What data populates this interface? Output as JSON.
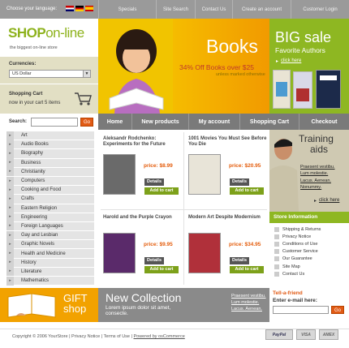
{
  "topbar": {
    "language_label": "Choose your language:",
    "nav": [
      "Specials",
      "Site Search",
      "Contact Us",
      "Create an account",
      "Customer Login"
    ]
  },
  "logo": {
    "main": "SHOP",
    "suffix": "on-line",
    "tagline": "the biggest on-line store"
  },
  "currencies": {
    "label": "Currencies:",
    "selected": "US Dollar"
  },
  "cart": {
    "label": "Shopping Cart",
    "text": "now in your cart  5 items"
  },
  "hero": {
    "title": "Books",
    "subtitle": "34% Off Books over $25",
    "note": "unless marked otherwise"
  },
  "big_sale": {
    "title": "BIG sale",
    "subtitle": "Favorite Authors",
    "link": "click here"
  },
  "search": {
    "label": "Search:",
    "go": "Go"
  },
  "main_nav": [
    "Home",
    "New products",
    "My account",
    "Shopping Cart",
    "Checkout"
  ],
  "categories": [
    "Art",
    "Audio Books",
    "Biography",
    "Business",
    "Christianity",
    "Computers",
    "Cooking and Food",
    "Crafts",
    "Eastern Religion",
    "Engineering",
    "Foreign Languages",
    "Gay and Lesbian",
    "Graphic Novels",
    "Health and Medicine",
    "History",
    "Literature",
    "Mathematics"
  ],
  "products": [
    {
      "title": "Aleksandr Rodchenko: Experiments for the Future",
      "price": "price: $8.99",
      "details": "Details",
      "add": "Add to cart",
      "cover_color": "#6a6a6a"
    },
    {
      "title": "1001 Movies You Must See Before You Die",
      "price": "price: $20.95",
      "details": "Details",
      "add": "Add to cart",
      "cover_color": "#e8e4d8"
    },
    {
      "title": "Harold and the Purple Crayon",
      "price": "price: $9.95",
      "details": "Details",
      "add": "Add to cart",
      "cover_color": "#5a2a6a"
    },
    {
      "title": "Modern Art Despite Modernism",
      "price": "price: $34.95",
      "details": "Details",
      "add": "Add to cart",
      "cover_color": "#b0303a"
    }
  ],
  "training": {
    "title_line1": "Training",
    "title_line2": "aids",
    "links": [
      "Praesent vestibu.",
      "Lum molestie.",
      "Lacus. Aenean.",
      "Nonummy."
    ],
    "click": "click here"
  },
  "store_info": {
    "title": "Store Information",
    "items": [
      "Shipping & Returns",
      "Privacy Notice",
      "Conditions of Use",
      "Customer Service",
      "Our Guarantee",
      "Site Map",
      "Contact Us"
    ]
  },
  "gift": {
    "line1": "GIFT",
    "line2": "shop"
  },
  "new_collection": {
    "title": "New Collection",
    "text1": "Lorem ipsum dolor sit amet,",
    "text2": "consecte.",
    "links": [
      "Praesent vestibu.",
      "Lum molestie.",
      "Lacus. Aenean."
    ]
  },
  "tell_friend": {
    "title": "Tell-a-friend",
    "label": "Enter e-mail here:",
    "go": "Go"
  },
  "footer": {
    "copyright": "Copyright © 2006 YourStore  |  Privacy Notice  |  Terms of Use  |",
    "powered": "Powered by osCommerce",
    "pay": [
      "PayPal",
      "VISA",
      "AMEX"
    ]
  },
  "colors": {
    "green": "#8eb722",
    "orange": "#e15a14",
    "gray_nav": "#7a7a7a"
  }
}
